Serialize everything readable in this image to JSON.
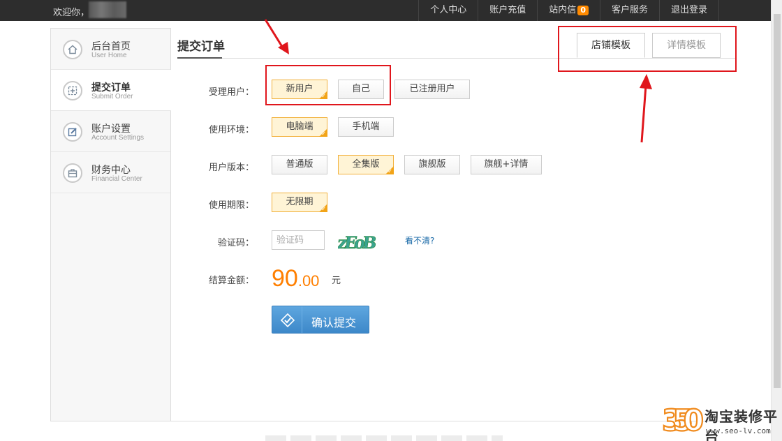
{
  "topbar": {
    "welcome": "欢迎你，",
    "nav": [
      "个人中心",
      "账户充值",
      "站内信",
      "客户服务",
      "退出登录"
    ],
    "message_count": "0"
  },
  "sidebar": {
    "items": [
      {
        "title": "后台首页",
        "subtitle": "User Home",
        "icon": "home-icon"
      },
      {
        "title": "提交订单",
        "subtitle": "Submit Order",
        "icon": "submit-order-icon"
      },
      {
        "title": "账户设置",
        "subtitle": "Account Settings",
        "icon": "edit-icon"
      },
      {
        "title": "财务中心",
        "subtitle": "Financial Center",
        "icon": "briefcase-icon"
      }
    ],
    "active_index": 1
  },
  "main": {
    "title": "提交订单",
    "tabs": [
      {
        "label": "店铺模板",
        "active": true
      },
      {
        "label": "详情模板",
        "active": false
      }
    ],
    "form": {
      "user_label": "受理用户：",
      "user_options": [
        "新用户",
        "自己",
        "已注册用户"
      ],
      "user_selected": "新用户",
      "env_label": "使用环境：",
      "env_options": [
        "电脑端",
        "手机端"
      ],
      "env_selected": "电脑端",
      "version_label": "用户版本：",
      "version_options": [
        "普通版",
        "全集版",
        "旗舰版",
        "旗舰+详情"
      ],
      "version_selected": "全集版",
      "term_label": "使用期限：",
      "term_options": [
        "无限期"
      ],
      "term_selected": "无限期",
      "captcha_label": "验证码：",
      "captcha_placeholder": "验证码",
      "captcha_text": "zEoB",
      "captcha_refresh": "看不清?",
      "amount_label": "结算金额：",
      "amount_int": "90",
      "amount_dec": ".00",
      "amount_unit": "元",
      "submit_label": "确认提交"
    }
  },
  "watermark": {
    "number": "350",
    "text": "淘宝装修平台",
    "url": "www.seo-lv.com"
  },
  "colors": {
    "accent_orange": "#ff7f00",
    "selected_border": "#f2b13c",
    "submit_blue": "#3d88c9",
    "annotation_red": "#e0161c"
  }
}
